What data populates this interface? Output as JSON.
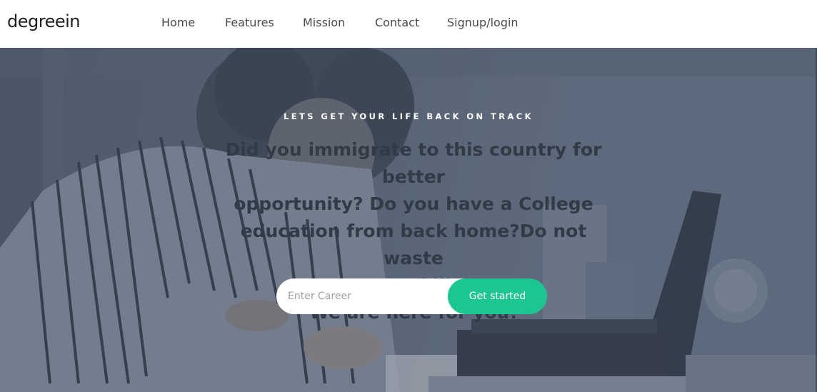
{
  "brand": {
    "name": "degreein"
  },
  "nav": {
    "items": [
      {
        "label": "Home"
      },
      {
        "label": "Features"
      },
      {
        "label": "Mission"
      },
      {
        "label": "Contact"
      },
      {
        "label": "Signup/login"
      }
    ]
  },
  "hero": {
    "eyebrow": "LETS GET YOUR LIFE BACK ON TRACK",
    "headline_lines": [
      "Did you immigrate to this country for better",
      "opportunity? Do you have a College",
      "education from back home?Do not waste",
      "your skills.",
      "We are here for you!"
    ],
    "background_image": "woman-working-at-desk-with-laptop-photo"
  },
  "search": {
    "placeholder": "Enter Career",
    "value": "",
    "button_label": "Get started"
  },
  "colors": {
    "accent": "#1cc591",
    "hero_overlay": "#5b6677",
    "navbar_bg": "#ffffff",
    "headline_text": "#323a46",
    "eyebrow_text": "#ffffff"
  }
}
